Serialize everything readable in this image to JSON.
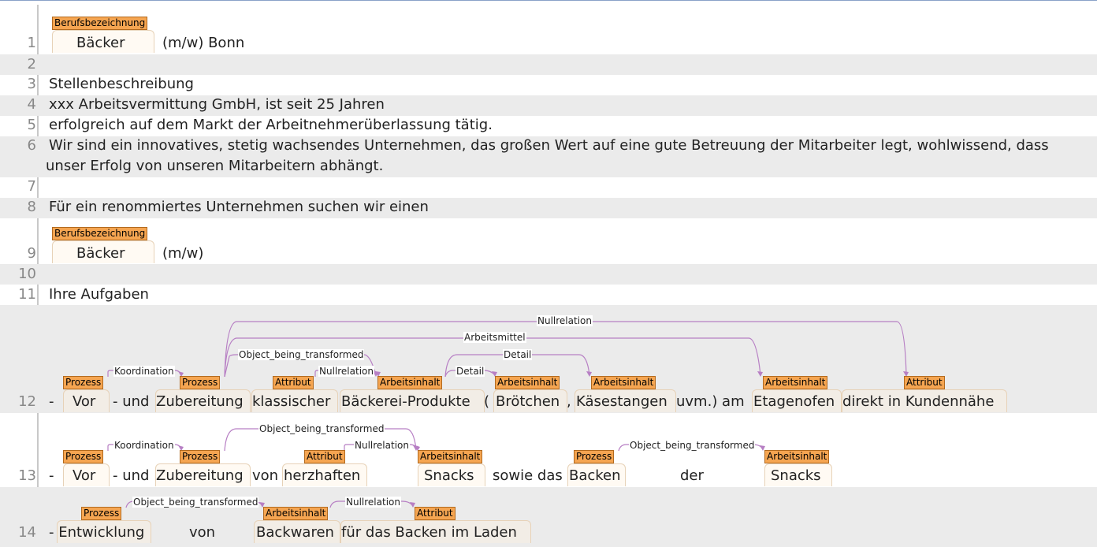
{
  "line_numbers": [
    "1",
    "2",
    "3",
    "4",
    "5",
    "6",
    "7",
    "8",
    "9",
    "10",
    "11",
    "12",
    "13",
    "14"
  ],
  "lines": {
    "l1": {
      "tok1": "Bäcker",
      "rest": "(m/w) Bonn"
    },
    "l3": "Stellenbeschreibung",
    "l4": "xxx Arbeitsvermittung GmbH, ist seit 25 Jahren",
    "l5": "erfolgreich auf dem Markt der Arbeitnehmerüberlassung tätig.",
    "l6a": "Wir sind ein innovatives, stetig wachsendes Unternehmen, das großen Wert auf eine gute Betreuung der Mitarbeiter legt, wohlwissend, dass",
    "l6b": "unser Erfolg von unseren Mitarbeitern abhängt.",
    "l8": "Für ein renommiertes Unternehmen suchen wir einen",
    "l9": {
      "tok1": "Bäcker",
      "rest": "(m/w)"
    },
    "l11": "Ihre Aufgaben",
    "l12": {
      "dash": "-",
      "vor": "Vor",
      "und": "- und",
      "zub": "Zubereitung",
      "klass": "klassischer",
      "baeck": "Bäckerei-Produkte",
      "paren": "(",
      "broet": "Brötchen",
      "comma": ",",
      "kaese": "Käsestangen",
      "uvm": "uvm.) am",
      "etage": "Etagenofen",
      "direkt": "direkt in Kundennähe"
    },
    "l13": {
      "dash": "-",
      "vor": "Vor",
      "und": "- und",
      "zub": "Zubereitung",
      "von": "von",
      "herz": "herzhaften",
      "snacks1": "Snacks",
      "sowie": "sowie das",
      "backen": "Backen",
      "der": "der",
      "snacks2": "Snacks"
    },
    "l14": {
      "entw": "- Entwicklung",
      "von": "von",
      "backw": "Backwaren",
      "fuer": "für das Backen im Laden"
    }
  },
  "entity_labels": {
    "berufsbezeichnung": "Berufsbezeichnung",
    "prozess": "Prozess",
    "attribut": "Attribut",
    "arbeitsinhalt": "Arbeitsinhalt"
  },
  "relation_labels": {
    "koordination": "Koordination",
    "nullrelation": "Nullrelation",
    "object_being_transformed": "Object_being_transformed",
    "detail": "Detail",
    "arbeitsmittel": "Arbeitsmittel"
  },
  "colors": {
    "label_bg": "#f5a551",
    "label_border": "#b26a1f",
    "arc": "#b77fc4",
    "alt_row": "#ebebeb"
  }
}
